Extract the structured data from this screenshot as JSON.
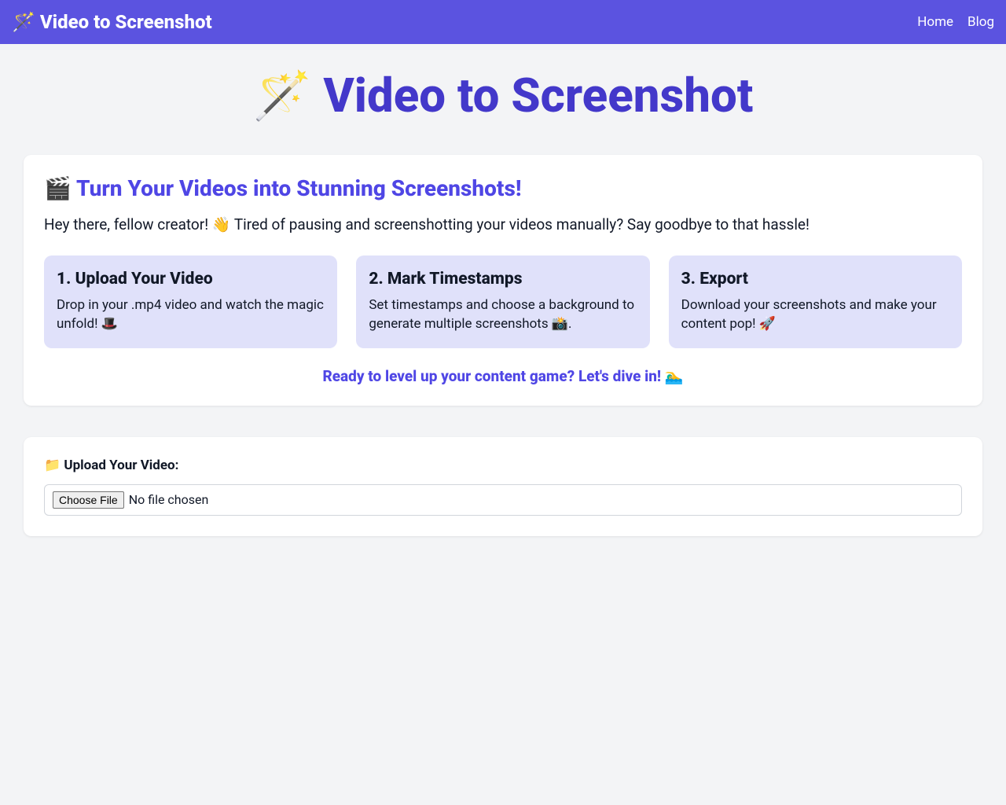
{
  "navbar": {
    "brand": "🪄 Video to Screenshot",
    "links": {
      "home": "Home",
      "blog": "Blog"
    }
  },
  "hero": {
    "title": "🪄 Video to Screenshot"
  },
  "intro": {
    "heading": "🎬 Turn Your Videos into Stunning Screenshots!",
    "paragraph": "Hey there, fellow creator! 👋 Tired of pausing and screenshotting your videos manually? Say goodbye to that hassle!",
    "cta": "Ready to level up your content game? Let's dive in! 🏊‍♂️"
  },
  "steps": [
    {
      "title": "1. Upload Your Video",
      "desc": "Drop in your .mp4 video and watch the magic unfold! 🎩"
    },
    {
      "title": "2. Mark Timestamps",
      "desc": "Set timestamps and choose a background to generate multiple screenshots 📸."
    },
    {
      "title": "3. Export",
      "desc": "Download your screenshots and make your content pop! 🚀"
    }
  ],
  "upload": {
    "label": "📁 Upload Your Video:",
    "button": "Choose File",
    "status": "No file chosen"
  }
}
